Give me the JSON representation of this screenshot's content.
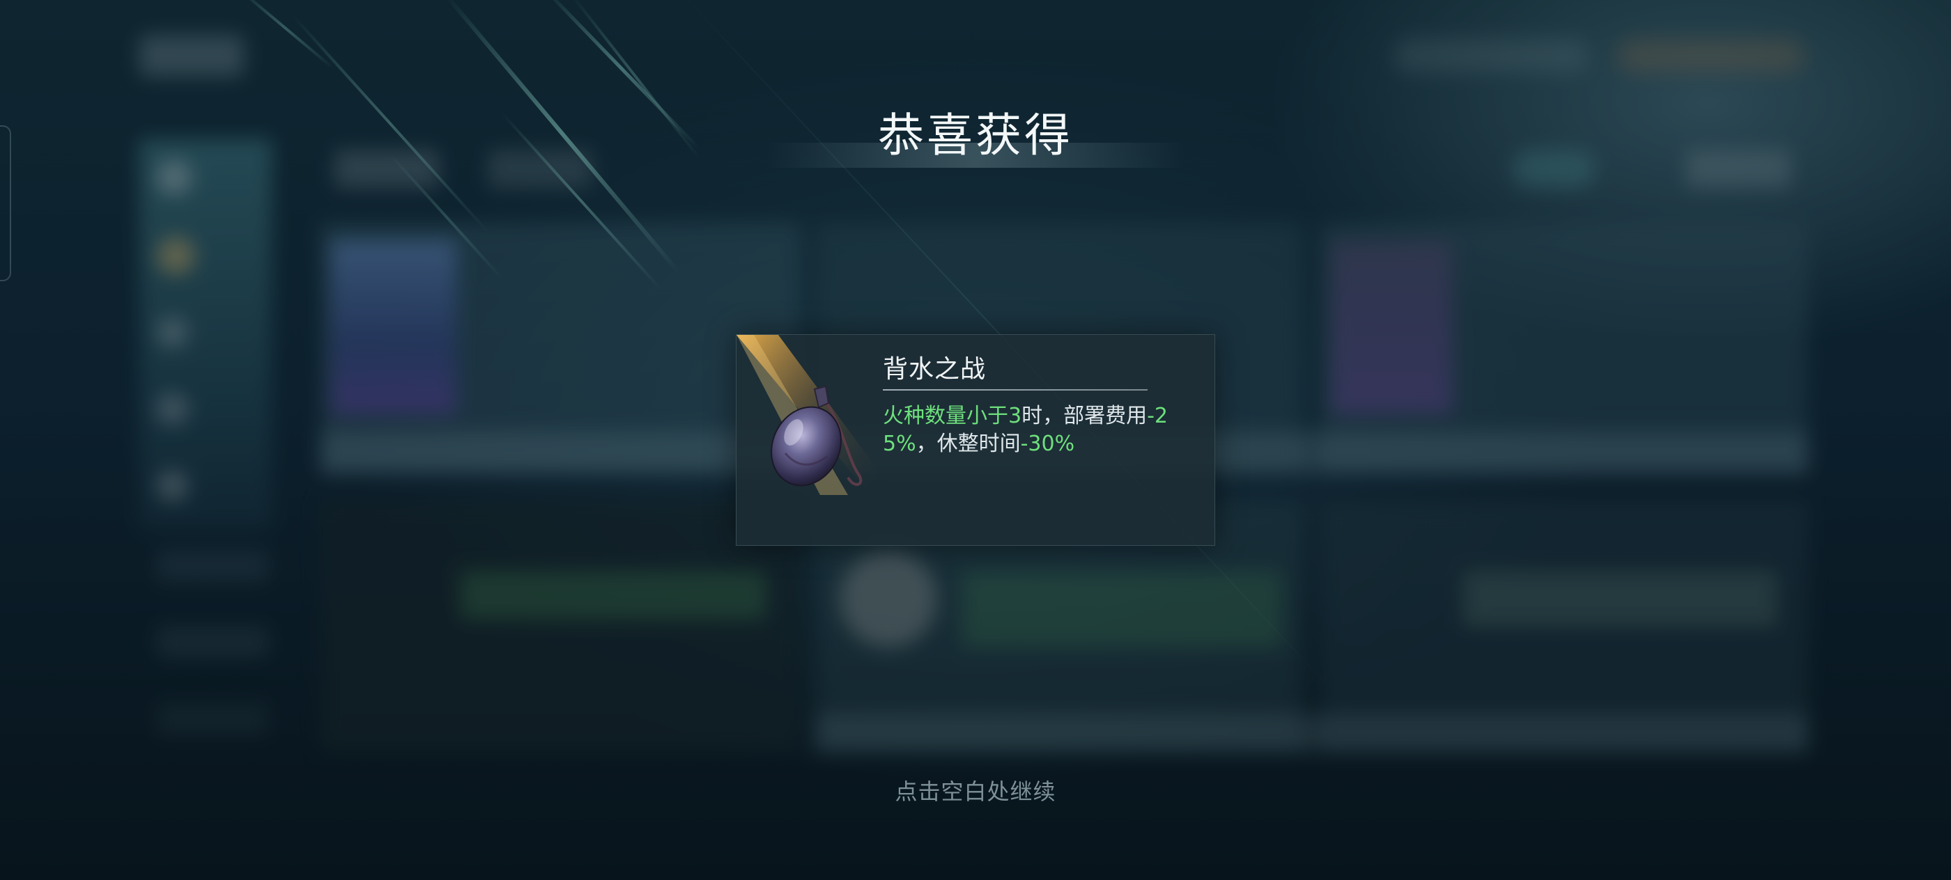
{
  "overlay": {
    "title": "恭喜获得",
    "continue_hint": "点击空白处继续"
  },
  "reward": {
    "name": "背水之战",
    "description_parts": {
      "p1": "火种数量小于3",
      "p2": "时，部署费用",
      "p3": "-25%",
      "p4": "，休整时间",
      "p5": "-30%"
    },
    "icon": "gourd-flask-icon"
  },
  "colors": {
    "highlight_green": "#6ee07c",
    "card_bg": "#1c2c34",
    "title_text": "#f3f7f8",
    "hint_text": "#7f9198"
  }
}
